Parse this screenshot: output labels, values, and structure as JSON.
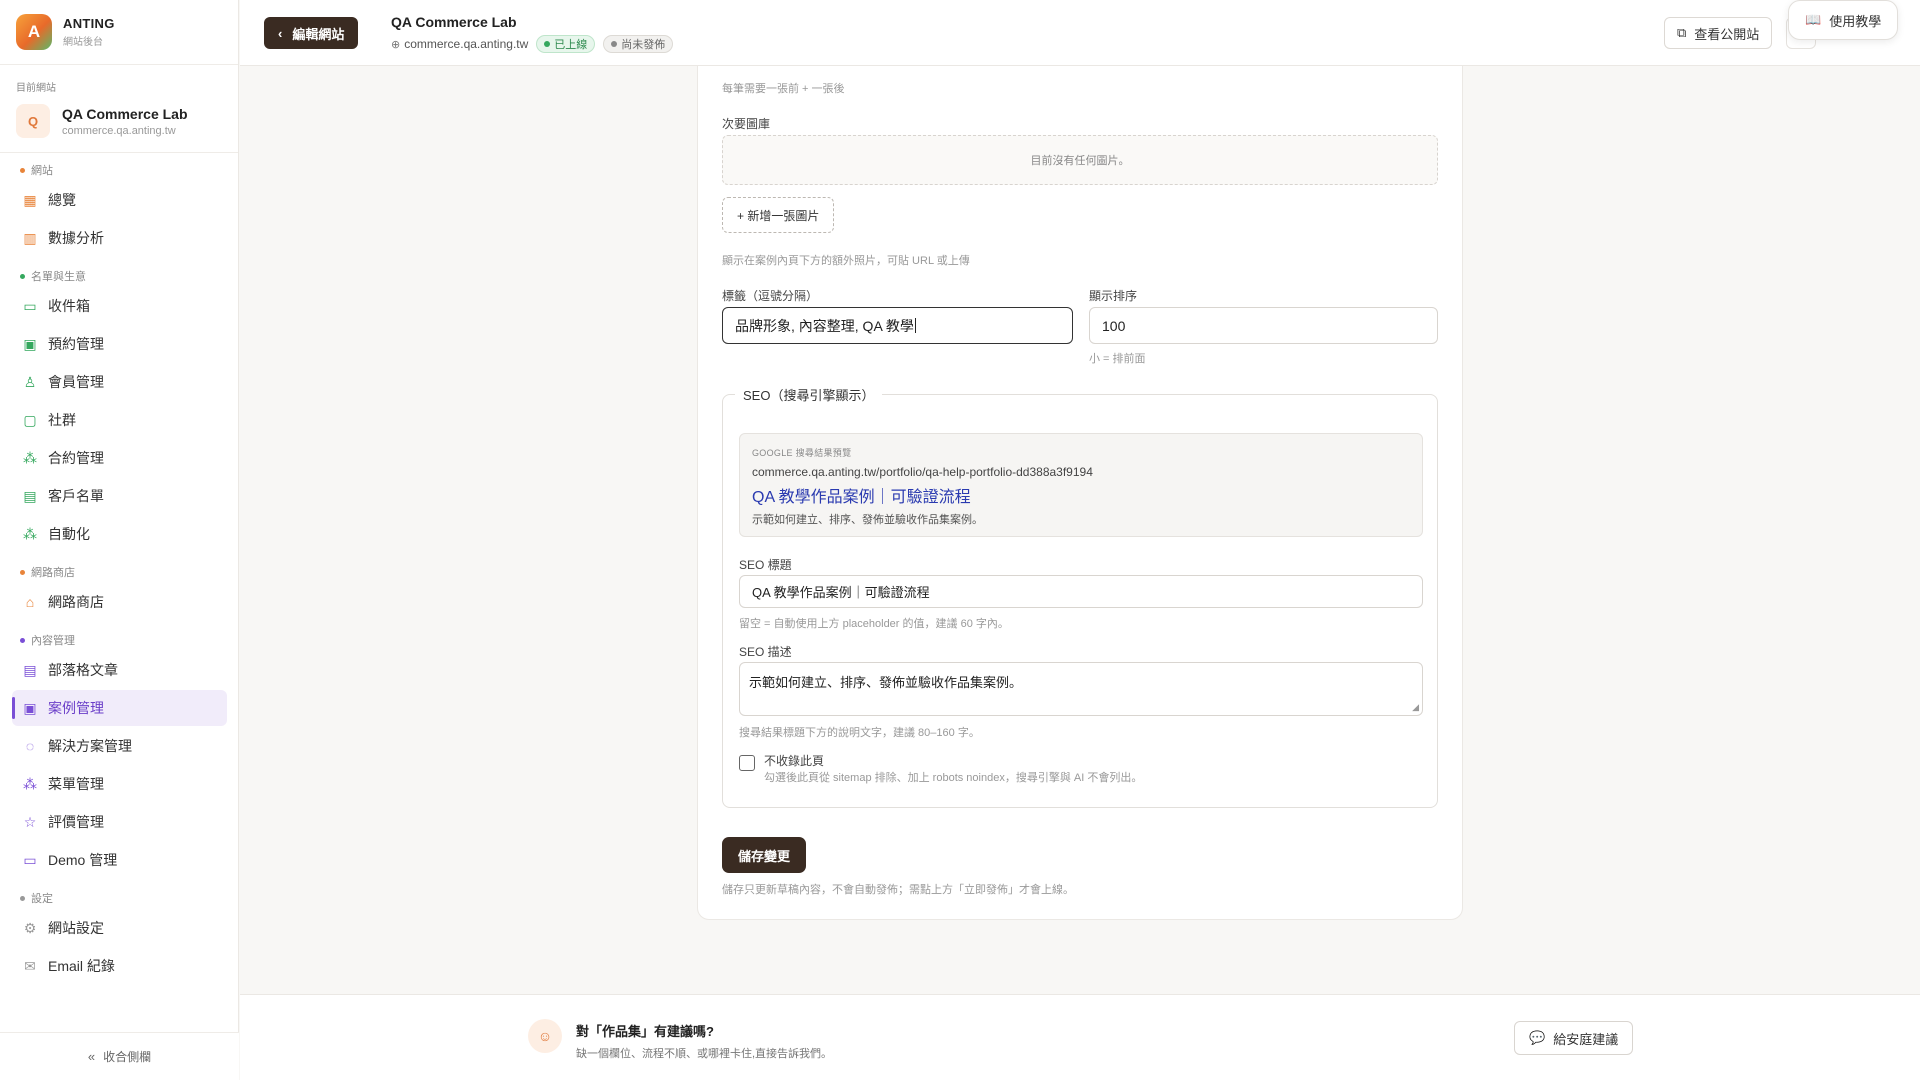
{
  "brand": {
    "logo_letter": "A",
    "name": "ANTING",
    "subtitle": "網站後台"
  },
  "current_site": {
    "label": "目前網站",
    "avatar_letter": "Q",
    "name": "QA Commerce Lab",
    "domain": "commerce.qa.anting.tw"
  },
  "sidebar": {
    "groups": [
      {
        "label": "網站",
        "color": "#e8843a",
        "items": [
          {
            "label": "總覽",
            "icon": "grid-icon"
          },
          {
            "label": "數據分析",
            "icon": "bar-chart-icon"
          }
        ]
      },
      {
        "label": "名單與生意",
        "color": "#35a85e",
        "items": [
          {
            "label": "收件箱",
            "icon": "inbox-icon"
          },
          {
            "label": "預約管理",
            "icon": "calendar-icon"
          },
          {
            "label": "會員管理",
            "icon": "users-icon"
          },
          {
            "label": "社群",
            "icon": "chat-icon"
          },
          {
            "label": "合約管理",
            "icon": "contract-icon"
          },
          {
            "label": "客戶名單",
            "icon": "contact-icon"
          },
          {
            "label": "自動化",
            "icon": "automation-icon"
          }
        ]
      },
      {
        "label": "網路商店",
        "color": "#e8843a",
        "items": [
          {
            "label": "網路商店",
            "icon": "store-icon"
          }
        ]
      },
      {
        "label": "內容管理",
        "color": "#7a4fd6",
        "items": [
          {
            "label": "部落格文章",
            "icon": "document-icon"
          },
          {
            "label": "案例管理",
            "icon": "briefcase-icon",
            "active": true
          },
          {
            "label": "解決方案管理",
            "icon": "lightbulb-icon"
          },
          {
            "label": "菜單管理",
            "icon": "menu-icon"
          },
          {
            "label": "評價管理",
            "icon": "star-icon"
          },
          {
            "label": "Demo 管理",
            "icon": "monitor-icon"
          }
        ]
      },
      {
        "label": "設定",
        "color": "#999999",
        "items": [
          {
            "label": "網站設定",
            "icon": "gear-icon"
          },
          {
            "label": "Email 紀錄",
            "icon": "mail-icon"
          }
        ]
      }
    ],
    "collapse_label": "收合側欄"
  },
  "topbar": {
    "back_label": "編輯網站",
    "site_title": "QA Commerce Lab",
    "site_domain": "commerce.qa.anting.tw",
    "badge_live": "已上線",
    "badge_unpublished": "尚未發佈",
    "public_site_label": "查看公開站",
    "tutorial_label": "使用教學"
  },
  "form": {
    "before_after_hint": "每筆需要一張前 + 一張後",
    "gallery_label": "次要圖庫",
    "gallery_empty": "目前沒有任何圖片。",
    "add_image_label": "+ 新增一張圖片",
    "gallery_hint": "顯示在案例內頁下方的額外照片，可貼 URL 或上傳",
    "tags_label": "標籤（逗號分隔）",
    "tags_value": "品牌形象, 內容整理, QA 教學",
    "order_label": "顯示排序",
    "order_value": "100",
    "order_hint": "小 = 排前面",
    "seo": {
      "legend": "SEO（搜尋引擎顯示）",
      "preview_label": "GOOGLE 搜尋結果預覽",
      "preview_url": "commerce.qa.anting.tw/portfolio/qa-help-portfolio-dd388a3f9194",
      "preview_title": "QA 教學作品案例｜可驗證流程",
      "preview_desc": "示範如何建立、排序、發佈並驗收作品集案例。",
      "title_label": "SEO 標題",
      "title_value": "QA 教學作品案例｜可驗證流程",
      "title_hint": "留空 = 自動使用上方 placeholder 的值，建議 60 字內。",
      "desc_label": "SEO 描述",
      "desc_value": "示範如何建立、排序、發佈並驗收作品集案例。",
      "desc_hint": "搜尋結果標題下方的說明文字，建議 80–160 字。",
      "noindex_label": "不收錄此頁",
      "noindex_hint": "勾選後此頁從 sitemap 排除、加上 robots noindex，搜尋引擎與 AI 不會列出。"
    },
    "save_label": "儲存變更",
    "save_hint": "儲存只更新草稿內容，不會自動發佈；需點上方「立即發佈」才會上線。"
  },
  "feedback": {
    "title": "對「作品集」有建議嗎?",
    "subtitle": "缺一個欄位、流程不順、或哪裡卡住,直接告訴我們。",
    "button_label": "給安庭建議"
  }
}
